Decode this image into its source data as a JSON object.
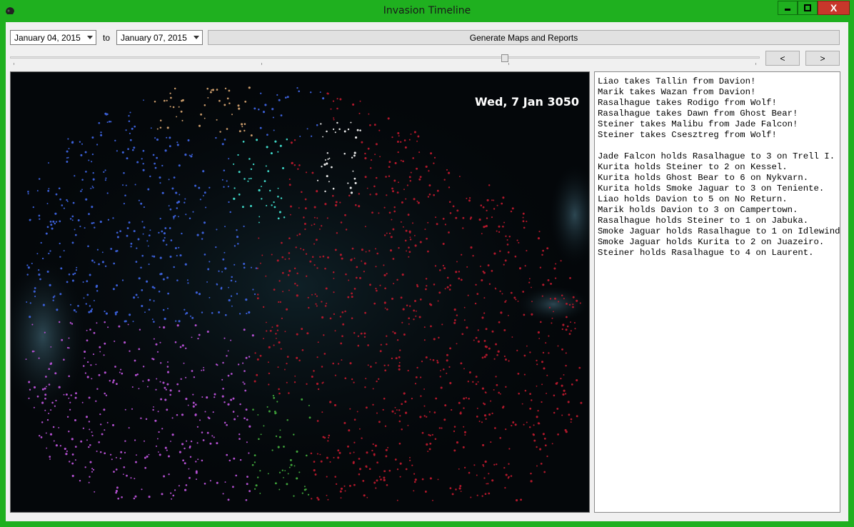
{
  "window": {
    "title": "Invasion Timeline",
    "close_glyph": "X"
  },
  "controls": {
    "from_date": "January 04, 2015",
    "to_label": "to",
    "to_date": "January 07, 2015",
    "generate_label": "Generate Maps and Reports",
    "prev_label": "<",
    "next_label": ">",
    "slider_fraction": 0.66
  },
  "map": {
    "date_label": "Wed, 7 Jan 3050"
  },
  "report": {
    "lines": [
      "Liao takes Tallin from Davion!",
      "Marik takes Wazan from Davion!",
      "Rasalhague takes Rodigo from Wolf!",
      "Rasalhague takes Dawn from Ghost Bear!",
      "Steiner takes Malibu from Jade Falcon!",
      "Steiner takes Csesztreg from Wolf!",
      "",
      "Jade Falcon holds Rasalhague to 3 on Trell I.",
      "Kurita holds Steiner to 2 on Kessel.",
      "Kurita holds Ghost Bear to 6 on Nykvarn.",
      "Kurita holds Smoke Jaguar to 3 on Teniente.",
      "Liao holds Davion to 5 on No Return.",
      "Marik holds Davion to 3 on Campertown.",
      "Rasalhague holds Steiner to 1 on Jabuka.",
      "Smoke Jaguar holds Rasalhague to 1 on Idlewind.",
      "Smoke Jaguar holds Kurita to 2 on Juazeiro.",
      "Steiner holds Rasalhague to 4 on Laurent."
    ]
  },
  "colors": {
    "titlebar": "#1fb01f",
    "close": "#c8372b",
    "map_bg": "#04070a",
    "faction_blue": "#3b5fd6",
    "faction_red": "#b0182b",
    "faction_purple": "#b24fcf",
    "faction_green": "#3fa23a",
    "faction_cyan": "#3fd8c8",
    "faction_white": "#e8e8e8",
    "faction_tan": "#c89a6a"
  }
}
